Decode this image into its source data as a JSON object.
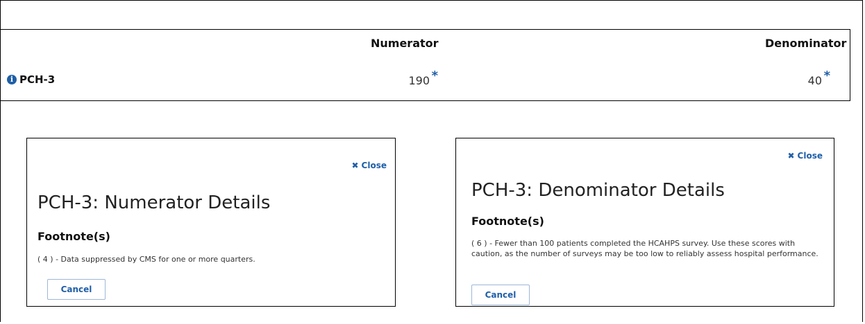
{
  "table": {
    "headers": {
      "numerator": "Numerator",
      "denominator": "Denominator"
    },
    "row": {
      "label": "PCH-3",
      "numerator": "190",
      "denominator": "40",
      "marker": "*"
    }
  },
  "numerator_modal": {
    "close_label": "Close",
    "title": "PCH-3: Numerator Details",
    "footnote_heading": "Footnote(s)",
    "footnote_text": "( 4 ) - Data suppressed by CMS for one or more quarters.",
    "cancel_label": "Cancel"
  },
  "denominator_modal": {
    "close_label": "Close",
    "title": "PCH-3: Denominator Details",
    "footnote_heading": "Footnote(s)",
    "footnote_text": "( 6 ) - Fewer than 100 patients completed the HCAHPS survey. Use these scores with caution, as the number of surveys may be too low to reliably assess hospital performance.",
    "cancel_label": "Cancel"
  },
  "colors": {
    "accent": "#1f5fa8",
    "border": "#000000"
  }
}
